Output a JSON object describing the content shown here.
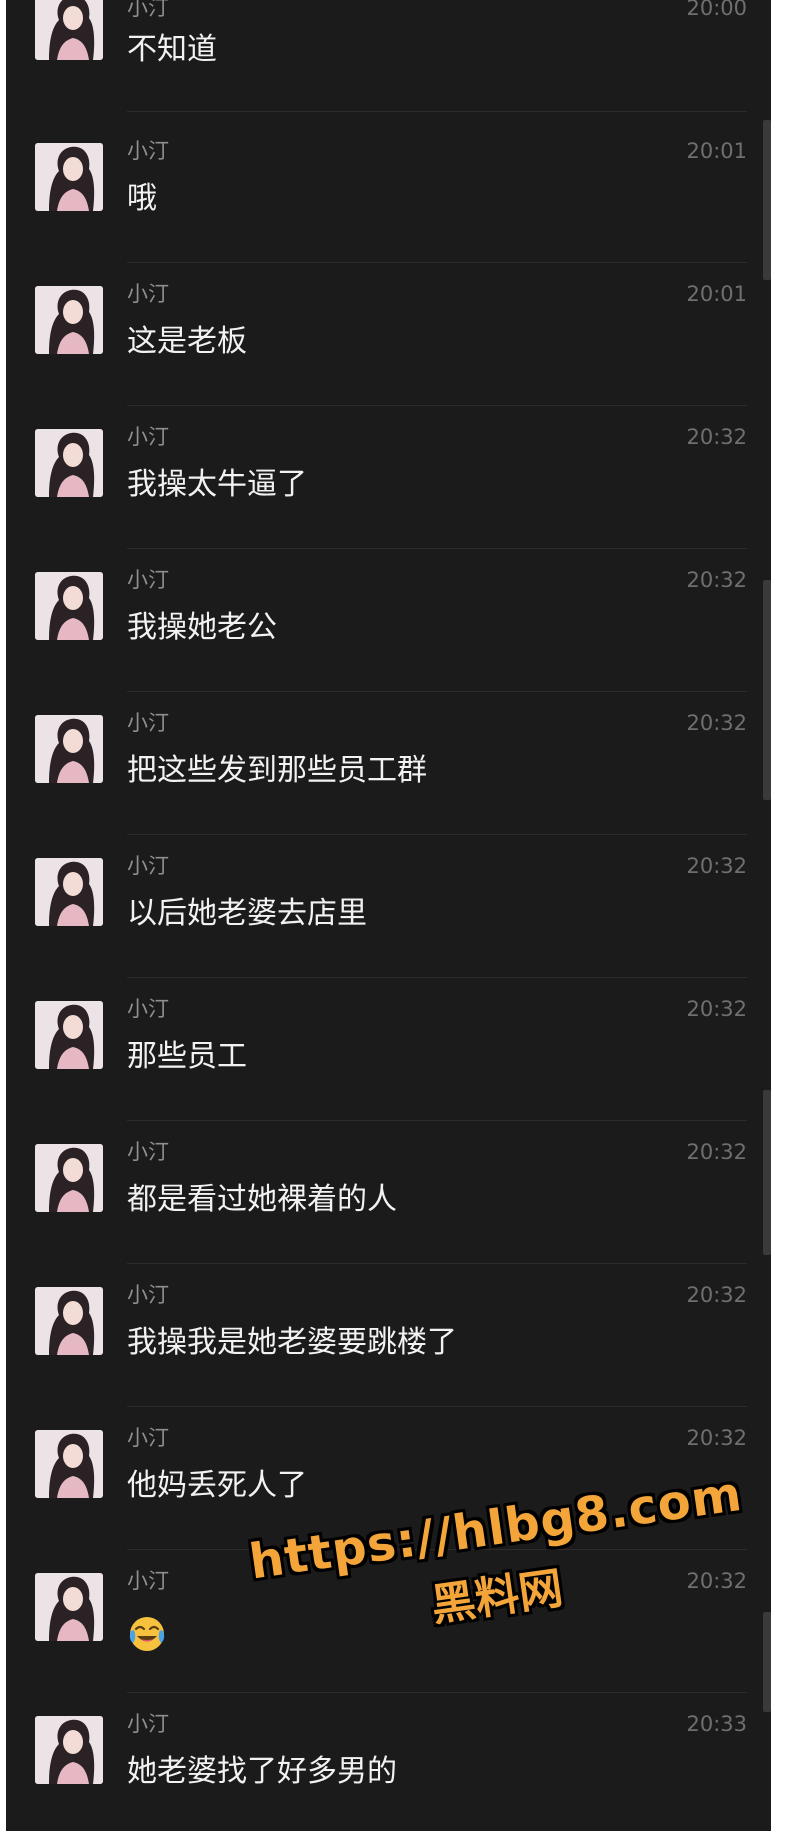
{
  "colors": {
    "background": "#1b1b1c",
    "text": "#f2f2f2",
    "name": "#8f8f92",
    "time": "#6f6f72",
    "watermark": "#f3a53a"
  },
  "messages": [
    {
      "sender": "小汀",
      "time": "20:00",
      "text": "不知道"
    },
    {
      "sender": "小汀",
      "time": "20:01",
      "text": "哦"
    },
    {
      "sender": "小汀",
      "time": "20:01",
      "text": "这是老板"
    },
    {
      "sender": "小汀",
      "time": "20:32",
      "text": "我操太牛逼了"
    },
    {
      "sender": "小汀",
      "time": "20:32",
      "text": "我操她老公"
    },
    {
      "sender": "小汀",
      "time": "20:32",
      "text": "把这些发到那些员工群"
    },
    {
      "sender": "小汀",
      "time": "20:32",
      "text": "以后她老婆去店里"
    },
    {
      "sender": "小汀",
      "time": "20:32",
      "text": "那些员工"
    },
    {
      "sender": "小汀",
      "time": "20:32",
      "text": "都是看过她裸着的人"
    },
    {
      "sender": "小汀",
      "time": "20:32",
      "text": "我操我是她老婆要跳楼了"
    },
    {
      "sender": "小汀",
      "time": "20:32",
      "text": "他妈丢死人了"
    },
    {
      "sender": "小汀",
      "time": "20:32",
      "text": "",
      "emoji": "crying-laughing-emoji"
    },
    {
      "sender": "小汀",
      "time": "20:33",
      "text": "她老婆找了好多男的"
    }
  ],
  "watermark": {
    "url": "https://hlbg8.com",
    "name": "黑料网"
  }
}
